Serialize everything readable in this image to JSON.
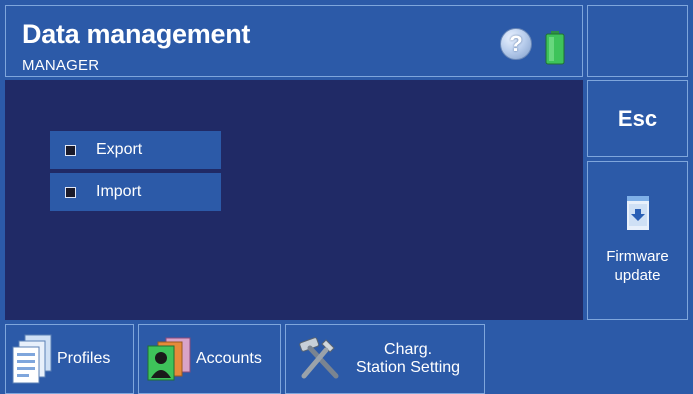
{
  "header": {
    "title": "Data management",
    "subtitle": "MANAGER",
    "help_glyph": "?",
    "help_icon": "help-icon",
    "battery_icon": "battery-icon"
  },
  "menu": {
    "items": [
      {
        "label": "Export",
        "checked": false
      },
      {
        "label": "Import",
        "checked": false
      }
    ]
  },
  "side": {
    "esc_label": "Esc",
    "firmware_line1": "Firmware",
    "firmware_line2": "update",
    "firmware_icon": "download-file-icon"
  },
  "tabs": [
    {
      "label": "Profiles",
      "icon": "profiles-icon"
    },
    {
      "label": "Accounts",
      "icon": "accounts-icon"
    },
    {
      "label_line1": "Charg.",
      "label_line2": "Station Setting",
      "icon": "tools-icon"
    }
  ],
  "colors": {
    "panel_blue": "#2c5aa8",
    "main_navy": "#202a66",
    "border_light": "#7fa6dc",
    "battery_green": "#3ec35a"
  }
}
